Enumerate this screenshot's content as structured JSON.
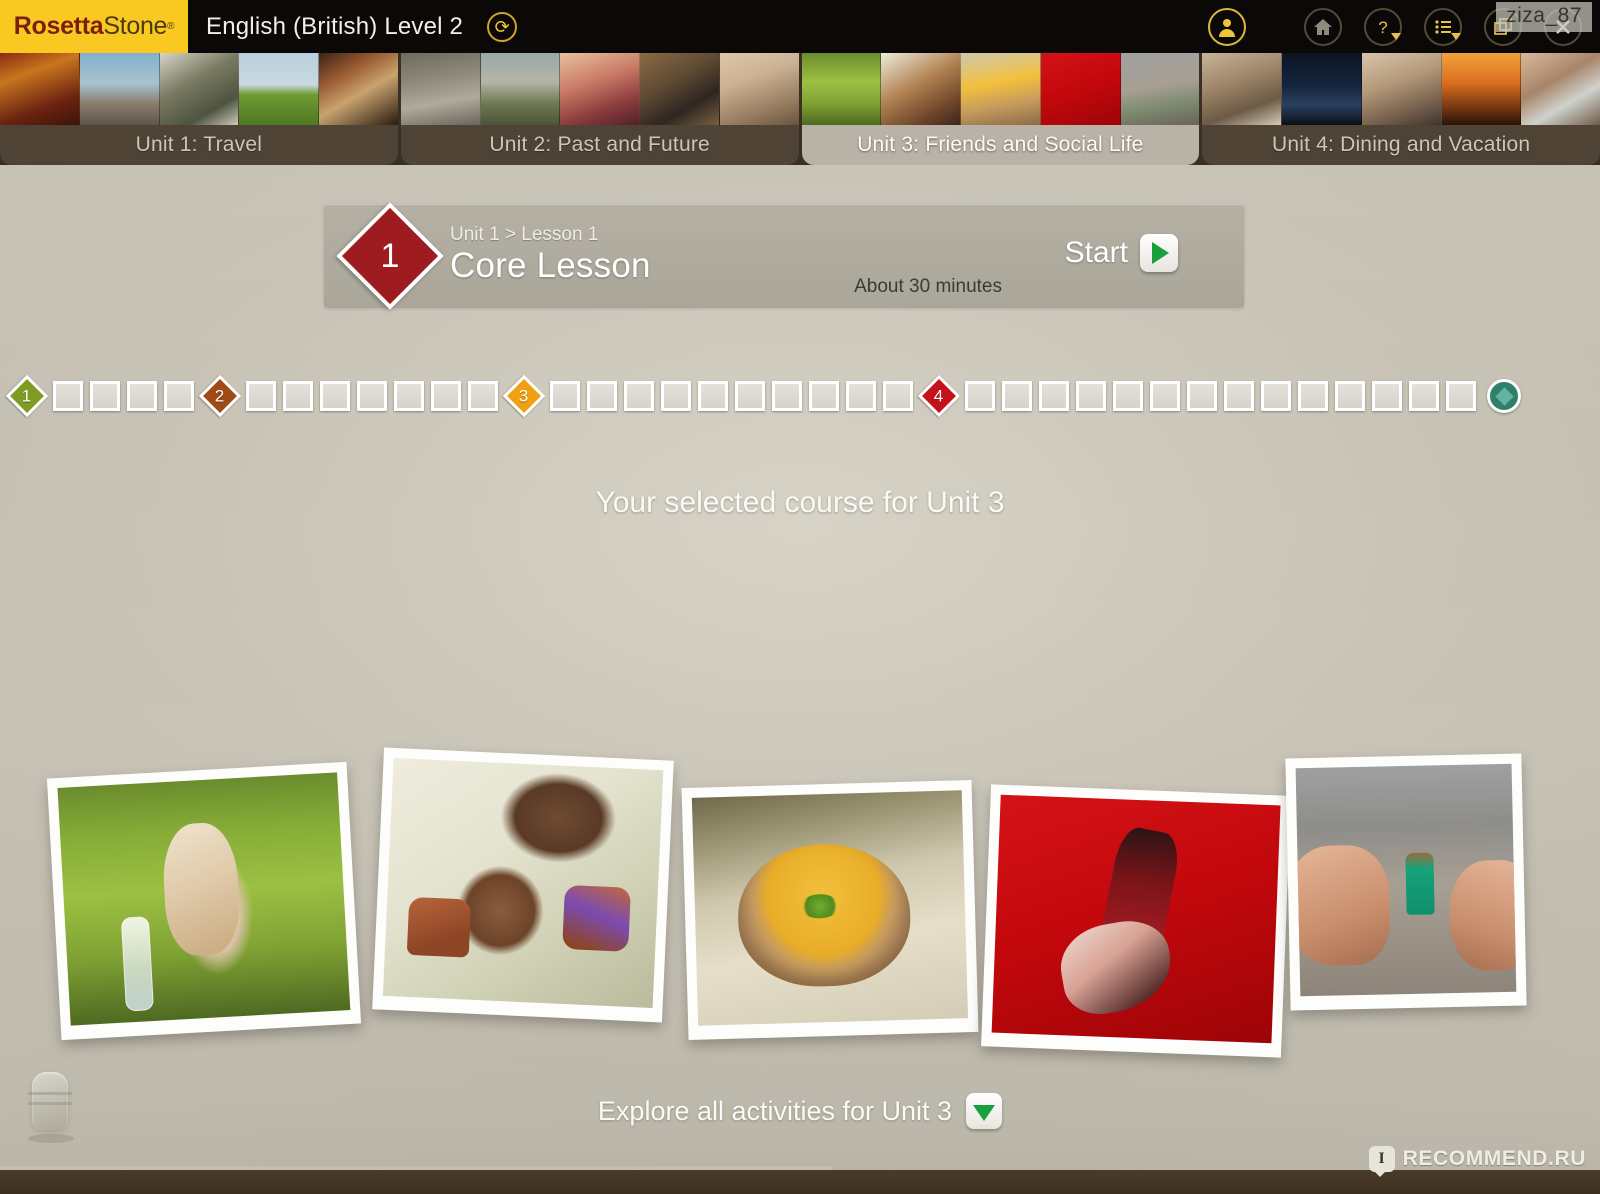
{
  "header": {
    "brand_primary": "Rosetta",
    "brand_secondary": "Stone",
    "brand_mark": "®",
    "course_title": "English (British) Level 2",
    "refresh_icon": "refresh-icon",
    "brand_bg": "#f9c821",
    "bar_bg": "#0a0907",
    "icons": [
      {
        "name": "user-profile-icon",
        "glyph": "person"
      },
      {
        "name": "home-icon",
        "glyph": "home"
      },
      {
        "name": "help-icon",
        "glyph": "question"
      },
      {
        "name": "menu-list-icon",
        "glyph": "list"
      },
      {
        "name": "restore-window-icon",
        "glyph": "windows"
      },
      {
        "name": "close-icon",
        "glyph": "x"
      }
    ]
  },
  "watermarks": {
    "user": "ziza_87",
    "site_badge": "I",
    "site": "RECOMMEND.RU"
  },
  "units": [
    {
      "label": "Unit 1: Travel",
      "active": false,
      "thumbs": [
        "theatre-interior",
        "group-photo",
        "elderly-man",
        "field-walker",
        "hands-cards"
      ]
    },
    {
      "label": "Unit 2: Past and Future",
      "active": false,
      "thumbs": [
        "skateboarder",
        "city-rooftop",
        "two-women-selfie",
        "man-in-suit",
        "wrist-watch"
      ]
    },
    {
      "label": "Unit 3: Friends and Social Life",
      "active": true,
      "thumbs": [
        "dog-with-bottle",
        "boy-painted-hands",
        "soup-bowl",
        "flamenco-dancer",
        "balcony-greeting"
      ]
    },
    {
      "label": "Unit 4: Dining and Vacation",
      "active": false,
      "thumbs": [
        "man-at-table",
        "night-fireworks",
        "group-of-friends",
        "sunset-cyclist",
        "camera-hands"
      ]
    }
  ],
  "lesson": {
    "badge_number": "1",
    "badge_color": "#9e1b20",
    "breadcrumb": "Unit 1 > Lesson 1",
    "title": "Core Lesson",
    "duration": "About 30 minutes",
    "start_label": "Start",
    "play_icon": "play-icon"
  },
  "progress": {
    "end_icon": "course-complete-icon",
    "steps": [
      {
        "type": "diamond",
        "label": "1",
        "color": "#7f9b22"
      },
      {
        "type": "square"
      },
      {
        "type": "square"
      },
      {
        "type": "square"
      },
      {
        "type": "square"
      },
      {
        "type": "diamond",
        "label": "2",
        "color": "#a14a16"
      },
      {
        "type": "square"
      },
      {
        "type": "square"
      },
      {
        "type": "square"
      },
      {
        "type": "square"
      },
      {
        "type": "square"
      },
      {
        "type": "square"
      },
      {
        "type": "square"
      },
      {
        "type": "diamond",
        "label": "3",
        "color": "#f0a010"
      },
      {
        "type": "square"
      },
      {
        "type": "square"
      },
      {
        "type": "square"
      },
      {
        "type": "square"
      },
      {
        "type": "square"
      },
      {
        "type": "square"
      },
      {
        "type": "square"
      },
      {
        "type": "square"
      },
      {
        "type": "square"
      },
      {
        "type": "square"
      },
      {
        "type": "diamond",
        "label": "4",
        "color": "#c5121a"
      },
      {
        "type": "square"
      },
      {
        "type": "square"
      },
      {
        "type": "square"
      },
      {
        "type": "square"
      },
      {
        "type": "square"
      },
      {
        "type": "square"
      },
      {
        "type": "square"
      },
      {
        "type": "square"
      },
      {
        "type": "square"
      },
      {
        "type": "square"
      },
      {
        "type": "square"
      },
      {
        "type": "square"
      },
      {
        "type": "square"
      },
      {
        "type": "square"
      },
      {
        "type": "end"
      }
    ]
  },
  "main": {
    "selected_course": "Your selected course for Unit 3",
    "explore_label": "Explore all activities for Unit 3",
    "explore_icon": "chevron-down-icon",
    "mic_icon": "microphone-icon"
  },
  "collage": [
    {
      "name": "photo-dog-with-bottle"
    },
    {
      "name": "photo-boy-painted-hands"
    },
    {
      "name": "photo-soup-bowl"
    },
    {
      "name": "photo-flamenco-dancer"
    },
    {
      "name": "photo-balcony-greeting"
    }
  ]
}
